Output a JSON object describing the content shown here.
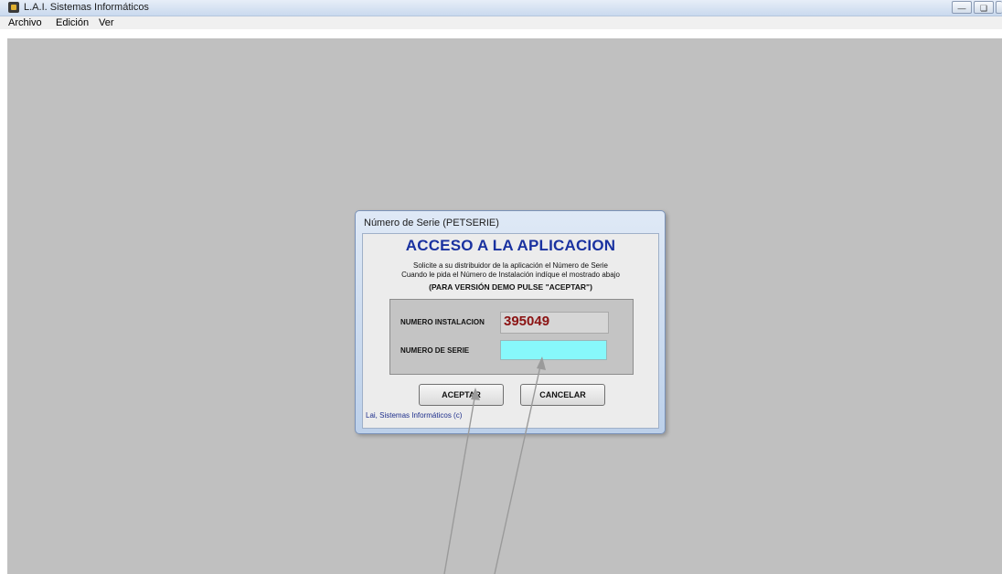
{
  "window": {
    "title": "L.A.I. Sistemas Informáticos",
    "icon": "app-icon",
    "controls": [
      "minimize",
      "restore",
      "close"
    ]
  },
  "menubar": {
    "items": [
      "Archivo",
      "Edición",
      "Ver"
    ]
  },
  "dialog": {
    "title": "Número de Serie (PETSERIE)",
    "heading": "ACCESO A LA APLICACION",
    "info_line1": "Solicite a su distribuidor de la aplicación el Número de Serie",
    "info_line2": "Cuando le pida el Número de Instalación indíque el mostrado abajo",
    "demo_note": "(PARA VERSIÓN DEMO PULSE \"ACEPTAR\")",
    "install_label": "NUMERO INSTALACION",
    "install_value": "395049",
    "serial_label": "NUMERO DE SERIE",
    "serial_value": "",
    "accept_label": "ACEPTAR",
    "cancel_label": "CANCELAR",
    "footer": "Lai, Sistemas Informáticos (c)"
  },
  "colors": {
    "heading": "#1a32a0",
    "install_value": "#8b1313",
    "serial_field": "#87f8fb",
    "workspace": "#c0c0c0"
  }
}
